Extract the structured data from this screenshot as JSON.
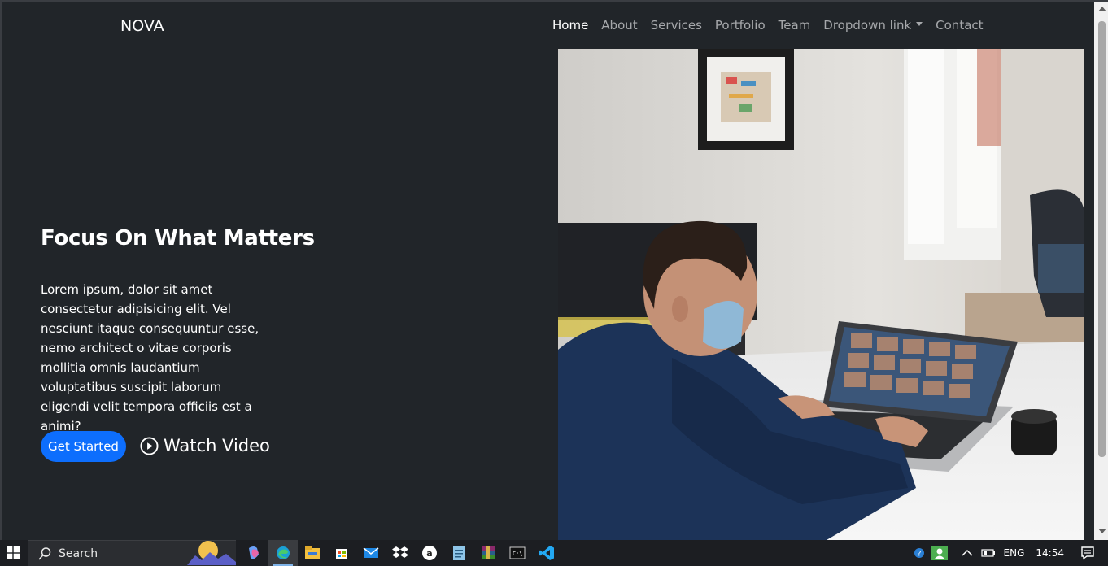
{
  "nav": {
    "brand": "NOVA",
    "links": [
      {
        "label": "Home",
        "active": true
      },
      {
        "label": "About"
      },
      {
        "label": "Services"
      },
      {
        "label": "Portfolio"
      },
      {
        "label": "Team"
      },
      {
        "label": "Dropdown link",
        "has_caret": true
      },
      {
        "label": "Contact"
      }
    ]
  },
  "hero": {
    "title": "Focus On What Matters",
    "text": "Lorem ipsum, dolor sit amet consectetur adipisicing elit. Vel nesciunt itaque consequuntur esse, nemo architect o vitae corporis mollitia omnis laudantium voluptatibus suscipit laborum eligendi velit tempora officiis est a animi?",
    "cta_label": "Get Started",
    "watch_label": "Watch Video",
    "image_icon": "man-on-video-call-photo"
  },
  "taskbar": {
    "search_label": "Search",
    "language": "ENG",
    "time": "14:54",
    "icons": [
      "copilot-icon",
      "edge-icon",
      "file-explorer-icon",
      "store-icon",
      "mail-icon",
      "dropbox-icon",
      "amazon-icon",
      "notepad-icon",
      "winrar-icon",
      "terminal-icon",
      "vscode-icon"
    ]
  },
  "colors": {
    "background": "#212529",
    "accent": "#0d6efd",
    "nav_inactive": "#a6a8ab"
  }
}
